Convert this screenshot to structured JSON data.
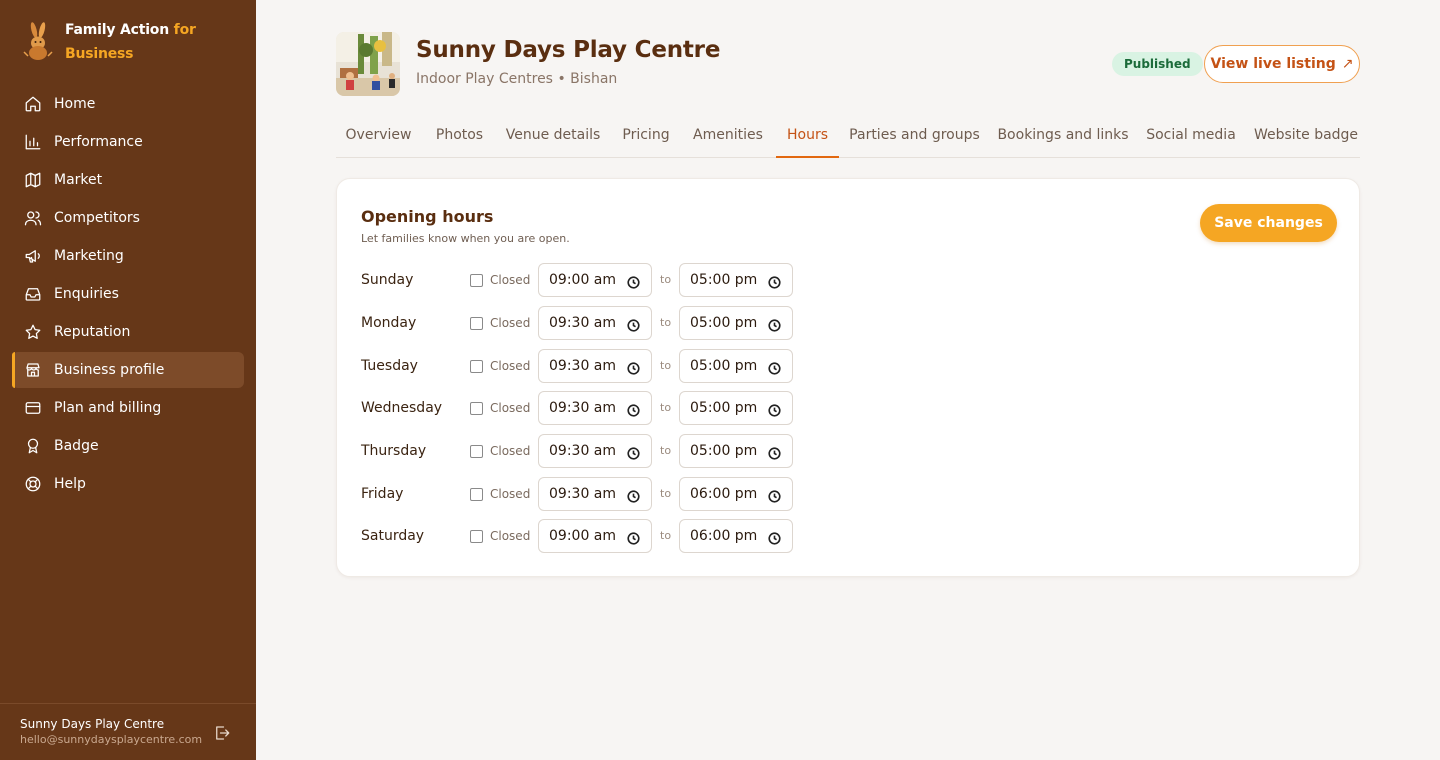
{
  "brand": {
    "line1": "Family Action ",
    "line1_accent": "for",
    "line2": "Business"
  },
  "nav": [
    {
      "label": "Home",
      "icon": "home-icon"
    },
    {
      "label": "Performance",
      "icon": "bar-chart-icon"
    },
    {
      "label": "Market",
      "icon": "map-icon"
    },
    {
      "label": "Competitors",
      "icon": "users-icon"
    },
    {
      "label": "Marketing",
      "icon": "megaphone-icon"
    },
    {
      "label": "Enquiries",
      "icon": "inbox-icon"
    },
    {
      "label": "Reputation",
      "icon": "star-icon"
    },
    {
      "label": "Business profile",
      "icon": "store-icon",
      "active": true
    },
    {
      "label": "Plan and billing",
      "icon": "credit-card-icon"
    },
    {
      "label": "Badge",
      "icon": "award-icon"
    },
    {
      "label": "Help",
      "icon": "life-buoy-icon"
    }
  ],
  "account": {
    "name": "Sunny Days Play Centre",
    "email": "hello@sunnydaysplaycentre.com"
  },
  "header": {
    "title": "Sunny Days Play Centre",
    "category": "Indoor Play Centres",
    "separator": "•",
    "location": "Bishan",
    "status_badge": "Published",
    "live_button": "View live listing",
    "live_button_icon": "↗"
  },
  "tabs": [
    {
      "label": "Overview"
    },
    {
      "label": "Photos"
    },
    {
      "label": "Venue details"
    },
    {
      "label": "Pricing"
    },
    {
      "label": "Amenities"
    },
    {
      "label": "Hours",
      "active": true
    },
    {
      "label": "Parties and groups"
    },
    {
      "label": "Bookings and links"
    },
    {
      "label": "Social media"
    },
    {
      "label": "Website badge"
    }
  ],
  "hours_card": {
    "title": "Opening hours",
    "subtitle": "Let families know when you are open.",
    "save_button": "Save changes",
    "closed_label": "Closed",
    "to_label": "to",
    "days": [
      {
        "day": "Sunday",
        "closed": false,
        "open": "09:00 am",
        "close": "05:00 pm"
      },
      {
        "day": "Monday",
        "closed": false,
        "open": "09:30 am",
        "close": "05:00 pm"
      },
      {
        "day": "Tuesday",
        "closed": false,
        "open": "09:30 am",
        "close": "05:00 pm"
      },
      {
        "day": "Wednesday",
        "closed": false,
        "open": "09:30 am",
        "close": "05:00 pm"
      },
      {
        "day": "Thursday",
        "closed": false,
        "open": "09:30 am",
        "close": "05:00 pm"
      },
      {
        "day": "Friday",
        "closed": false,
        "open": "09:30 am",
        "close": "06:00 pm"
      },
      {
        "day": "Saturday",
        "closed": false,
        "open": "09:00 am",
        "close": "06:00 pm"
      }
    ]
  },
  "colors": {
    "sidebar_bg": "#663718",
    "accent": "#f5a623",
    "active_tab": "#c45215",
    "title": "#5a2e10",
    "published_bg": "#d9f3e3",
    "published_text": "#1c6b3a"
  }
}
